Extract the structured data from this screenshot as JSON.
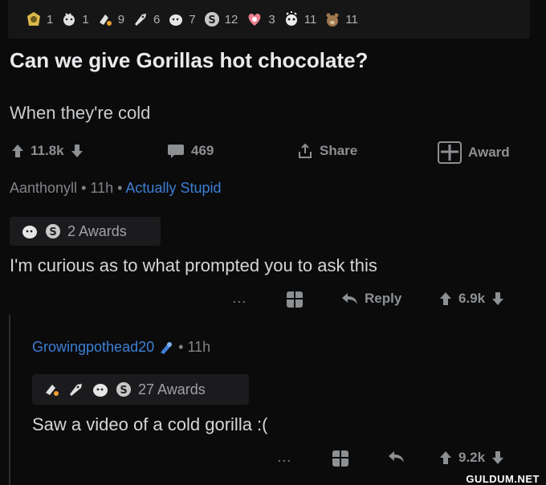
{
  "post": {
    "awards": [
      {
        "icon": "platinum-icon",
        "count": "1",
        "color": "#d9b94a"
      },
      {
        "icon": "wholesome-icon",
        "count": "1",
        "color": "#e0e0e0"
      },
      {
        "icon": "helpful-icon",
        "count": "9",
        "color": "#e0e0e0"
      },
      {
        "icon": "rocket-icon",
        "count": "6",
        "color": "#e0e0e0"
      },
      {
        "icon": "doge-icon",
        "count": "7",
        "color": "#e6e6e6"
      },
      {
        "icon": "silver-icon",
        "count": "12",
        "color": "#c8c8c8"
      },
      {
        "icon": "heart-icon",
        "count": "3",
        "color": "#f08090"
      },
      {
        "icon": "facepalm-icon",
        "count": "11",
        "color": "#ececec"
      },
      {
        "icon": "bear-icon",
        "count": "11",
        "color": "#a07850"
      }
    ],
    "title": "Can we give Gorillas hot chocolate?",
    "body": "When they're cold",
    "score": "11.8k",
    "comments": "469",
    "share_label": "Share",
    "award_label": "Award"
  },
  "comment1": {
    "author": "Aanthonyll",
    "age": "11h",
    "flair": "Actually Stupid",
    "awards_label": "2 Awards",
    "text": "I'm curious as to what prompted you to ask this",
    "more": "...",
    "reply_label": "Reply",
    "score": "6.9k"
  },
  "comment2": {
    "author": "Growingpothead20",
    "age": "11h",
    "awards_label": "27 Awards",
    "text": "Saw a video of a cold gorilla :(",
    "more": "...",
    "score": "9.2k"
  },
  "watermark": "GULDUM.NET",
  "colors": {
    "accent_blue": "#3e7fd6",
    "background": "#0b0b0c"
  }
}
